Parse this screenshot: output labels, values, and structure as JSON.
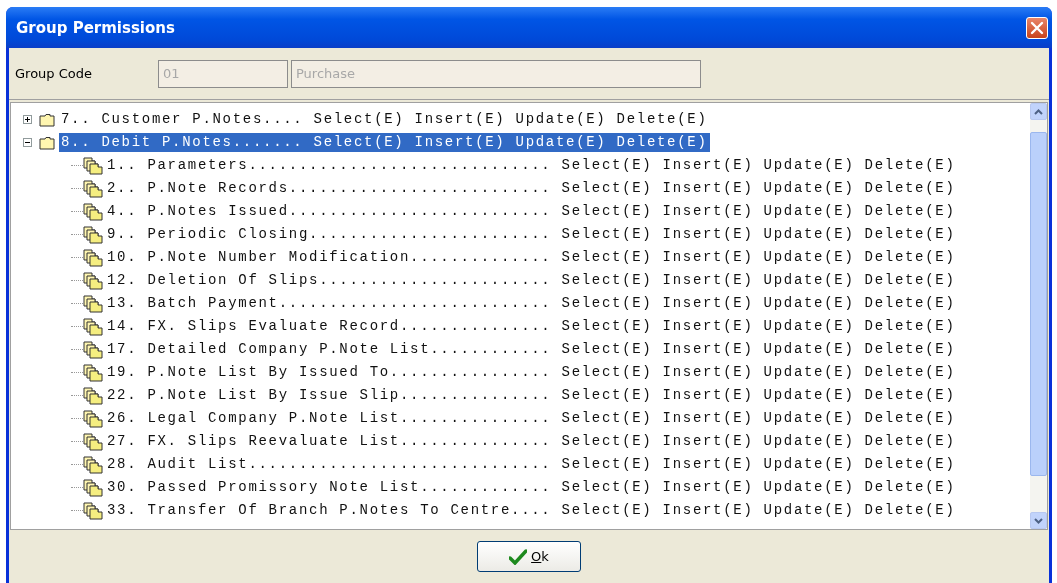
{
  "window": {
    "title": "Group Permissions"
  },
  "group_code": {
    "label": "Group Code",
    "code": "01",
    "name": "Purchase"
  },
  "tree": [
    {
      "label": "7.. Customer P.Notes.... Select(E) Insert(E) Update(E) Delete(E)",
      "expanded": false,
      "selected": false
    },
    {
      "label": "8.. Debit P.Notes....... Select(E) Insert(E) Update(E) Delete(E)",
      "expanded": true,
      "selected": true,
      "children": [
        {
          "label": "1.. Parameters.............................. Select(E) Insert(E) Update(E) Delete(E)",
          "selected": false
        },
        {
          "label": "2.. P.Note Records.......................... Select(E) Insert(E) Update(E) Delete(E)",
          "selected": false
        },
        {
          "label": "4.. P.Notes Issued.......................... Select(E) Insert(E) Update(E) Delete(E)",
          "selected": false
        },
        {
          "label": "9.. Periodic Closing........................ Select(E) Insert(E) Update(E) Delete(E)",
          "selected": false
        },
        {
          "label": "10. P.Note Number Modification.............. Select(E) Insert(E) Update(E) Delete(E)",
          "selected": false
        },
        {
          "label": "12. Deletion Of Slips....................... Select(E) Insert(E) Update(E) Delete(E)",
          "selected": false
        },
        {
          "label": "13. Batch Payment........................... Select(E) Insert(E) Update(E) Delete(E)",
          "selected": false
        },
        {
          "label": "14. FX. Slips Evaluate Record............... Select(E) Insert(E) Update(E) Delete(E)",
          "selected": false
        },
        {
          "label": "17. Detailed Company P.Note List............ Select(E) Insert(E) Update(E) Delete(E)",
          "selected": false
        },
        {
          "label": "19. P.Note List By Issued To................ Select(E) Insert(E) Update(E) Delete(E)",
          "selected": false
        },
        {
          "label": "22. P.Note List By Issue Slip............... Select(E) Insert(E) Update(E) Delete(E)",
          "selected": false
        },
        {
          "label": "26. Legal Company P.Note List............... Select(E) Insert(E) Update(E) Delete(E)",
          "selected": false
        },
        {
          "label": "27. FX. Slips Reevaluate List............... Select(E) Insert(E) Update(E) Delete(E)",
          "selected": false
        },
        {
          "label": "28. Audit List.............................. Select(E) Insert(E) Update(E) Delete(E)",
          "selected": false
        },
        {
          "label": "30. Passed Promissory Note List............. Select(E) Insert(E) Update(E) Delete(E)",
          "selected": false
        },
        {
          "label": "33. Transfer Of Branch P.Notes To Centre.... Select(E) Insert(E) Update(E) Delete(E)",
          "selected": false
        }
      ]
    }
  ],
  "buttons": [
    {
      "label": "Ok"
    }
  ]
}
